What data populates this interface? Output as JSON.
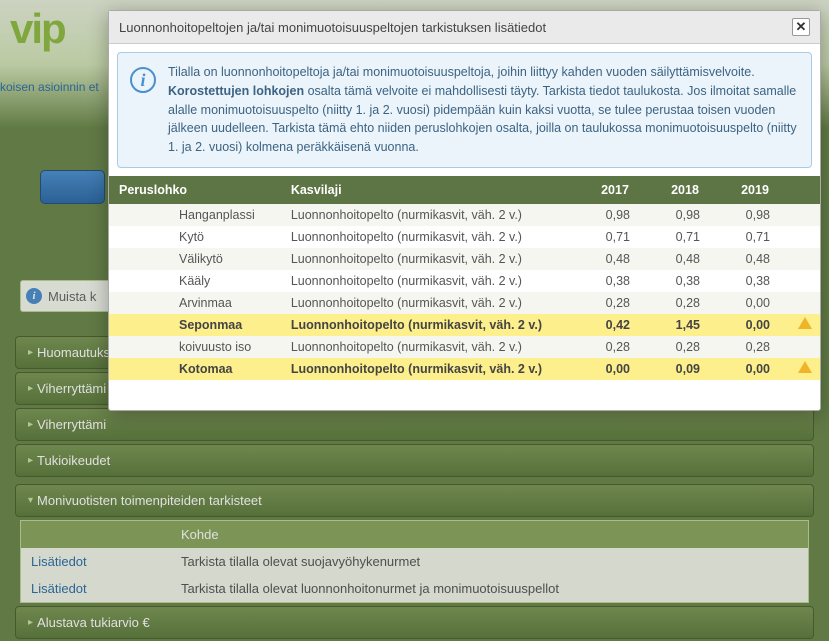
{
  "logo": "vip",
  "breadcrumb": "koisen asioinnin et",
  "notice": "Muista k",
  "accordions": {
    "a1": "Huomautukse",
    "a2": "Viherryttämi",
    "a3": "Viherryttämi",
    "a4": "Tukioikeudet",
    "a5": "Monivuotisten toimenpiteiden tarkisteet",
    "a6": "Alustava tukiarvio €"
  },
  "subtable": {
    "header_col2": "Kohde",
    "rows": [
      {
        "link": "Lisätiedot",
        "text": "Tarkista tilalla olevat suojavyöhykenurmet"
      },
      {
        "link": "Lisätiedot",
        "text": "Tarkista tilalla olevat luonnonhoitonurmet ja monimuotoisuuspellot"
      }
    ]
  },
  "modal": {
    "title": "Luonnonhoitopeltojen ja/tai monimuotoisuuspeltojen tarkistuksen lisätiedot",
    "info_prefix": "Tilalla on luonnonhoitopeltoja ja/tai monimuotoisuuspeltoja, joihin liittyy kahden vuoden säilyttämisvelvoite. ",
    "info_bold": "Korostettujen lohkojen",
    "info_rest": " osalta tämä velvoite ei mahdollisesti täyty. Tarkista tiedot taulukosta. Jos ilmoitat samalle alalle monimuotoisuuspelto (niitty 1. ja 2. vuosi) pidempään kuin kaksi vuotta, se tulee perustaa toisen vuoden jälkeen uudelleen. Tarkista tämä ehto niiden peruslohkojen osalta, joilla on taulukossa monimuotoisuuspelto (niitty 1. ja 2. vuosi) kolmena peräkkäisenä vuonna.",
    "columns": {
      "c1": "Peruslohko",
      "c2": "Kasvilaji",
      "c3": "2017",
      "c4": "2018",
      "c5": "2019"
    },
    "rows": [
      {
        "name": "Hanganplassi",
        "kind": "Luonnonhoitopelto (nurmikasvit, väh. 2 v.)",
        "v2017": "0,98",
        "v2018": "0,98",
        "v2019": "0,98",
        "hl": false,
        "warn": false
      },
      {
        "name": "Kytö",
        "kind": "Luonnonhoitopelto (nurmikasvit, väh. 2 v.)",
        "v2017": "0,71",
        "v2018": "0,71",
        "v2019": "0,71",
        "hl": false,
        "warn": false
      },
      {
        "name": "Välikytö",
        "kind": "Luonnonhoitopelto (nurmikasvit, väh. 2 v.)",
        "v2017": "0,48",
        "v2018": "0,48",
        "v2019": "0,48",
        "hl": false,
        "warn": false
      },
      {
        "name": "Kääly",
        "kind": "Luonnonhoitopelto (nurmikasvit, väh. 2 v.)",
        "v2017": "0,38",
        "v2018": "0,38",
        "v2019": "0,38",
        "hl": false,
        "warn": false
      },
      {
        "name": "Arvinmaa",
        "kind": "Luonnonhoitopelto (nurmikasvit, väh. 2 v.)",
        "v2017": "0,28",
        "v2018": "0,28",
        "v2019": "0,00",
        "hl": false,
        "warn": false
      },
      {
        "name": "Seponmaa",
        "kind": "Luonnonhoitopelto (nurmikasvit, väh. 2 v.)",
        "v2017": "0,42",
        "v2018": "1,45",
        "v2019": "0,00",
        "hl": true,
        "warn": true
      },
      {
        "name": "koivuusto iso",
        "kind": "Luonnonhoitopelto (nurmikasvit, väh. 2 v.)",
        "v2017": "0,28",
        "v2018": "0,28",
        "v2019": "0,28",
        "hl": false,
        "warn": false
      },
      {
        "name": "Kotomaa",
        "kind": "Luonnonhoitopelto (nurmikasvit, väh. 2 v.)",
        "v2017": "0,00",
        "v2018": "0,09",
        "v2019": "0,00",
        "hl": true,
        "warn": true
      }
    ]
  }
}
